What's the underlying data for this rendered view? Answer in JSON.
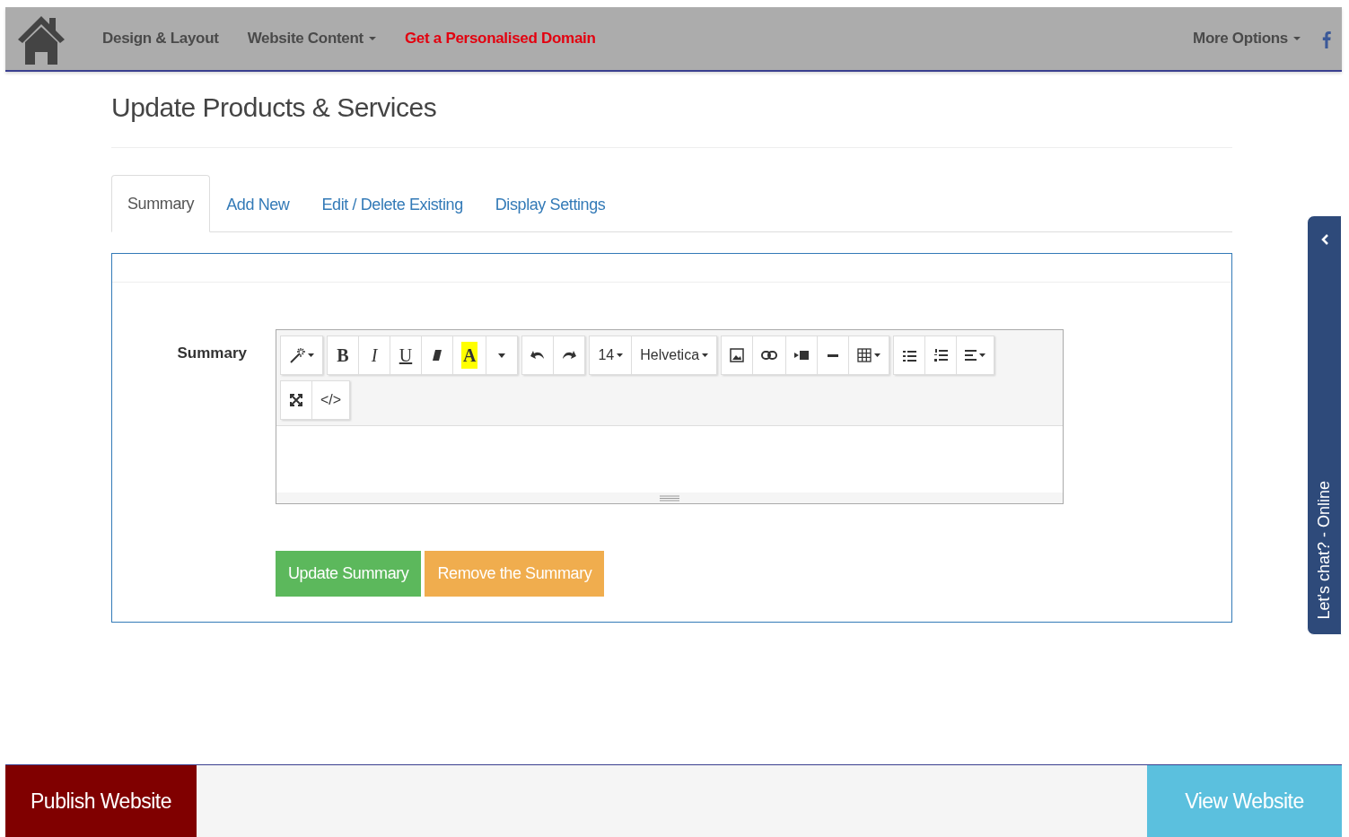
{
  "navbar": {
    "items": [
      {
        "label": "Design & Layout",
        "dropdown": false,
        "highlight": false
      },
      {
        "label": "Website Content",
        "dropdown": true,
        "highlight": false
      },
      {
        "label": "Get a Personalised Domain",
        "dropdown": false,
        "highlight": true
      }
    ],
    "right_items": [
      {
        "label": "More Options",
        "dropdown": true
      }
    ]
  },
  "page_title": "Update Products & Services",
  "tabs": [
    {
      "label": "Summary",
      "selected": true
    },
    {
      "label": "Add New",
      "selected": false
    },
    {
      "label": "Edit / Delete Existing",
      "selected": false
    },
    {
      "label": "Display Settings",
      "selected": false
    }
  ],
  "form": {
    "label": "Summary",
    "toolbar": [
      [
        {
          "kind": "wand",
          "dropdown": true
        }
      ],
      [
        {
          "kind": "bold",
          "text": "B"
        },
        {
          "kind": "italic",
          "text": "I"
        },
        {
          "kind": "underline",
          "text": "U"
        },
        {
          "kind": "eraser"
        },
        {
          "kind": "highlight",
          "text": "A"
        },
        {
          "kind": "caret"
        }
      ],
      [
        {
          "kind": "undo"
        },
        {
          "kind": "redo"
        }
      ],
      [
        {
          "kind": "text",
          "text": "14",
          "dropdown": true
        },
        {
          "kind": "text",
          "text": "Helvetica",
          "dropdown": true
        }
      ],
      [
        {
          "kind": "picture"
        },
        {
          "kind": "link"
        },
        {
          "kind": "video"
        },
        {
          "kind": "rule"
        },
        {
          "kind": "table",
          "dropdown": true
        }
      ],
      [
        {
          "kind": "bullets"
        },
        {
          "kind": "numbers"
        },
        {
          "kind": "align",
          "dropdown": true
        }
      ],
      [
        {
          "kind": "expand"
        },
        {
          "kind": "text",
          "text": "</>"
        }
      ]
    ],
    "buttons": [
      {
        "label": "Update Summary",
        "kind": "success"
      },
      {
        "label": "Remove the Summary",
        "kind": "warning"
      }
    ]
  },
  "chat_tab": {
    "label": "Let's chat? - Online"
  },
  "footer": {
    "publish": "Publish Website",
    "view": "View Website"
  }
}
